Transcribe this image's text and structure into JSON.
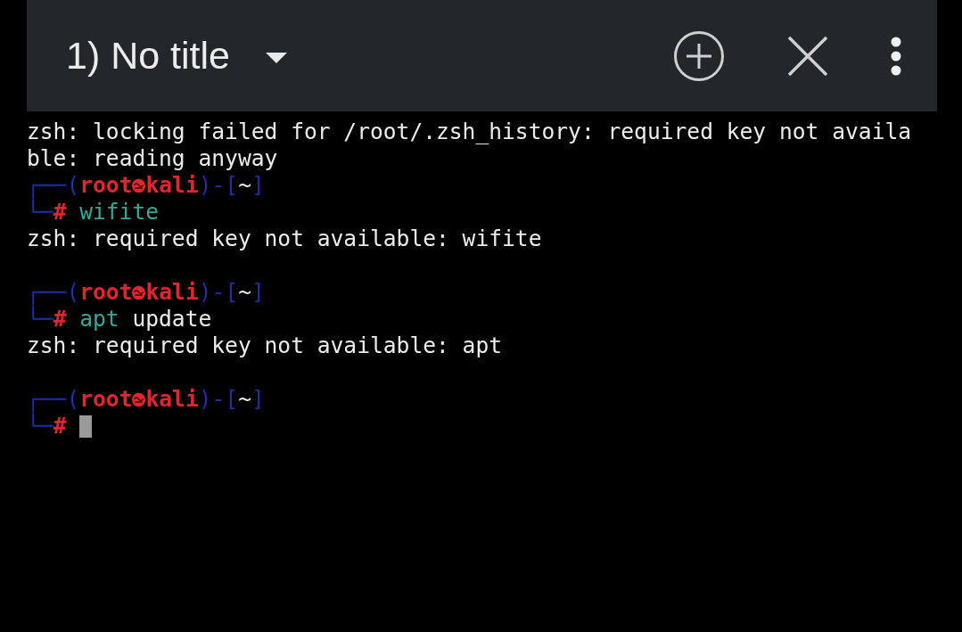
{
  "toolbar": {
    "title": "1) No title"
  },
  "terminal": {
    "lines": [
      {
        "kind": "text",
        "segments": [
          {
            "kind": "plain",
            "text": "zsh: locking failed for /root/.zsh_history: required key not availa"
          }
        ]
      },
      {
        "kind": "text",
        "segments": [
          {
            "kind": "plain",
            "text": "ble: reading anyway"
          }
        ]
      },
      {
        "kind": "text",
        "segments": [
          {
            "kind": "frame",
            "text": "┌──("
          },
          {
            "kind": "user",
            "text": "root"
          },
          {
            "kind": "emblem"
          },
          {
            "kind": "user",
            "text": "kali"
          },
          {
            "kind": "frame",
            "text": ")-["
          },
          {
            "kind": "plain",
            "text": "~"
          },
          {
            "kind": "frame",
            "text": "]"
          }
        ]
      },
      {
        "kind": "text",
        "segments": [
          {
            "kind": "frame",
            "text": "└─"
          },
          {
            "kind": "user",
            "text": "#"
          },
          {
            "kind": "space"
          },
          {
            "kind": "command",
            "text": "wifite"
          }
        ]
      },
      {
        "kind": "text",
        "segments": [
          {
            "kind": "plain",
            "text": "zsh: required key not available: wifite"
          }
        ]
      },
      {
        "kind": "blank"
      },
      {
        "kind": "text",
        "segments": [
          {
            "kind": "frame",
            "text": "┌──("
          },
          {
            "kind": "user",
            "text": "root"
          },
          {
            "kind": "emblem"
          },
          {
            "kind": "user",
            "text": "kali"
          },
          {
            "kind": "frame",
            "text": ")-["
          },
          {
            "kind": "plain",
            "text": "~"
          },
          {
            "kind": "frame",
            "text": "]"
          }
        ]
      },
      {
        "kind": "text",
        "segments": [
          {
            "kind": "frame",
            "text": "└─"
          },
          {
            "kind": "user",
            "text": "#"
          },
          {
            "kind": "space"
          },
          {
            "kind": "command",
            "text": "apt"
          },
          {
            "kind": "plain",
            "text": " update"
          }
        ]
      },
      {
        "kind": "text",
        "segments": [
          {
            "kind": "plain",
            "text": "zsh: required key not available: apt"
          }
        ]
      },
      {
        "kind": "blank"
      },
      {
        "kind": "text",
        "segments": [
          {
            "kind": "frame",
            "text": "┌──("
          },
          {
            "kind": "user",
            "text": "root"
          },
          {
            "kind": "emblem"
          },
          {
            "kind": "user",
            "text": "kali"
          },
          {
            "kind": "frame",
            "text": ")-["
          },
          {
            "kind": "plain",
            "text": "~"
          },
          {
            "kind": "frame",
            "text": "]"
          }
        ]
      },
      {
        "kind": "text",
        "segments": [
          {
            "kind": "frame",
            "text": "└─"
          },
          {
            "kind": "user",
            "text": "#"
          },
          {
            "kind": "space"
          },
          {
            "kind": "cursor"
          }
        ]
      }
    ]
  }
}
